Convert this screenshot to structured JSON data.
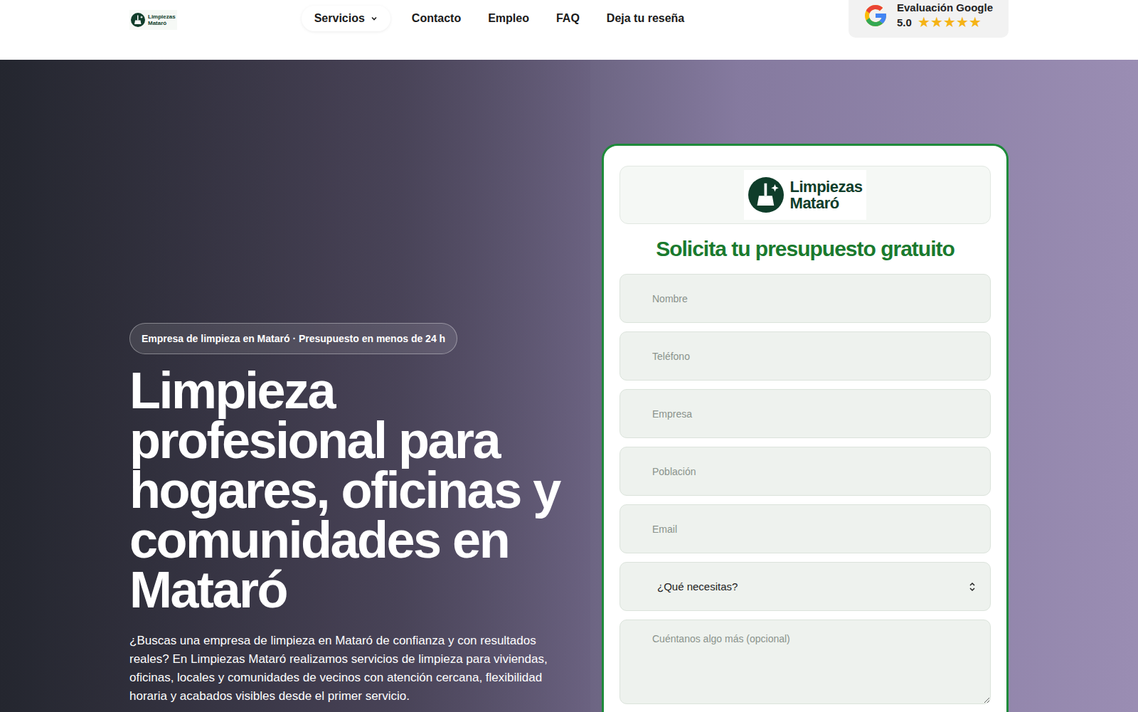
{
  "header": {
    "logo": {
      "line1": "Limpiezas",
      "line2": "Mataró"
    },
    "nav": [
      {
        "label": "Servicios",
        "has_menu": true
      },
      {
        "label": "Contacto",
        "has_menu": false
      },
      {
        "label": "Empleo",
        "has_menu": false
      },
      {
        "label": "FAQ",
        "has_menu": false
      },
      {
        "label": "Deja tu reseña",
        "has_menu": false
      }
    ],
    "rating": {
      "title": "Evaluación Google",
      "score": "5.0",
      "stars": 5
    }
  },
  "hero": {
    "badge": "Empresa de limpieza en Mataró · Presupuesto en menos de 24 h",
    "title": "Limpieza profesional para hogares, oficinas y comunidades en Mataró",
    "text": "¿Buscas una empresa de limpieza en Mataró de confianza y con resultados reales? En Limpiezas Mataró realizamos servicios de limpieza para viviendas, oficinas, locales y comunidades de vecinos con atención cercana, flexibilidad horaria y acabados visibles desde el primer servicio."
  },
  "form": {
    "logo": {
      "line1": "Limpiezas",
      "line2": "Mataró"
    },
    "title": "Solicita tu presupuesto gratuito",
    "fields": [
      {
        "placeholder": "Nombre"
      },
      {
        "placeholder": "Teléfono"
      },
      {
        "placeholder": "Empresa"
      },
      {
        "placeholder": "Población"
      },
      {
        "placeholder": "Email"
      }
    ],
    "select": {
      "value": "¿Qué necesitas?"
    },
    "message": {
      "placeholder": "Cuéntanos algo más (opcional)"
    }
  }
}
